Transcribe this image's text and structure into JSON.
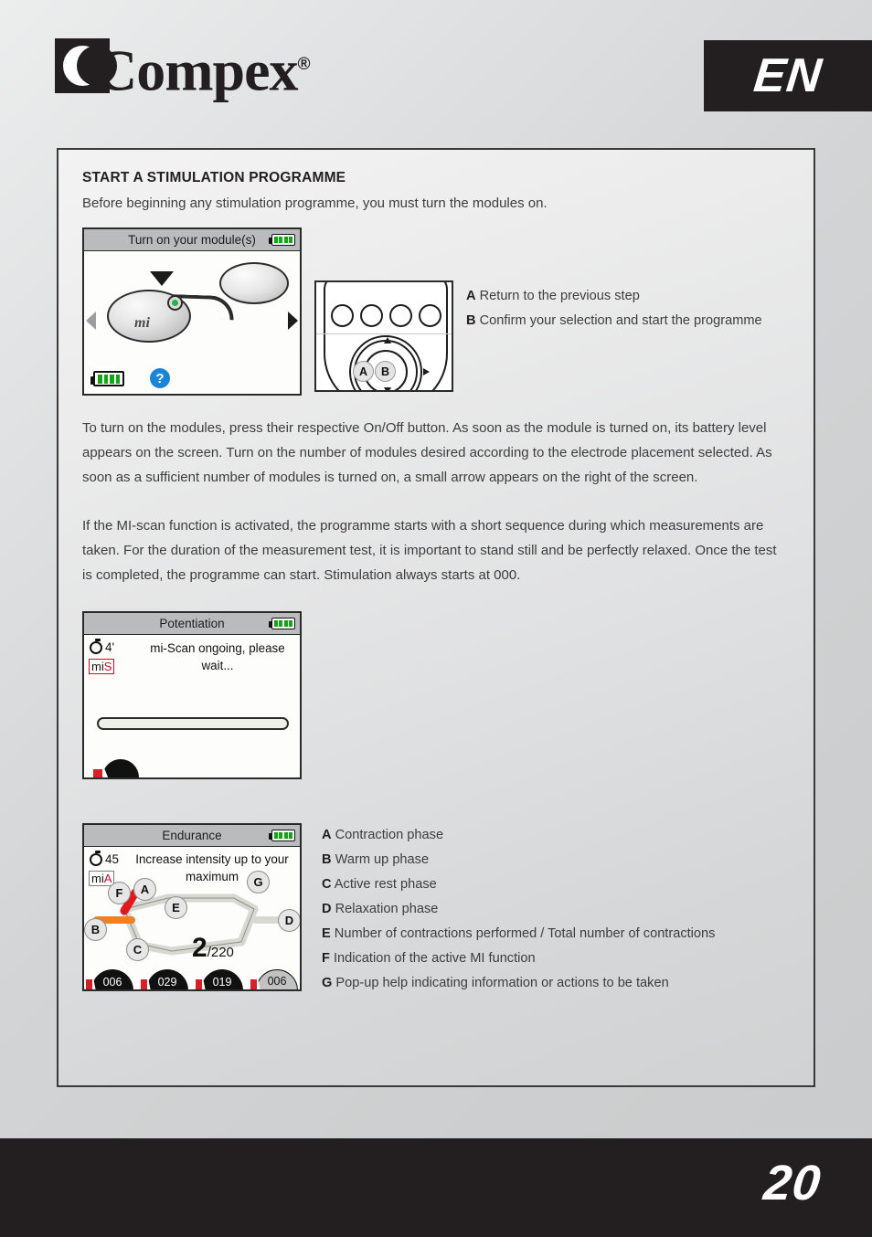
{
  "header": {
    "brand": "Compex",
    "brand_reg": "®",
    "language_tab": "EN"
  },
  "section": {
    "title": "START A STIMULATION PROGRAMME",
    "intro": "Before beginning any stimulation programme, you must turn the modules on.",
    "paragraph_1": "To turn on the modules, press their respective On/Off button. As soon as the module is turned on, its battery level appears on the screen. Turn on the number of modules desired according to the electrode placement selected. As soon as a sufficient number of modules is turned on, a small arrow appears on the right of the screen.",
    "paragraph_2": "If the MI-scan function is activated, the programme starts with a short sequence during which measurements are taken. For the duration of the measurement test, it is important to stand still and be perfectly relaxed. Once the test is completed, the programme can start. Stimulation always starts at 000."
  },
  "screen_turn_on": {
    "title": "Turn on your module(s)",
    "module_label": "mi",
    "help_glyph": "?"
  },
  "button_pad": {
    "label_a": "A",
    "label_b": "B"
  },
  "button_legend": [
    {
      "key": "A",
      "text": "Return to the previous step"
    },
    {
      "key": "B",
      "text": "Confirm your selection and start the programme"
    }
  ],
  "screen_potentiation": {
    "title": "Potentiation",
    "timer": "4'",
    "mi_badge_prefix": "mi",
    "mi_badge_suffix": "S",
    "message": "mi-Scan ongoing, please wait..."
  },
  "screen_endurance": {
    "title": "Endurance",
    "timer": "45",
    "mi_badge_prefix": "mi",
    "mi_badge_suffix": "A",
    "message": "Increase intensity up to your maximum",
    "contractions_done": "2",
    "contractions_total": "/220",
    "callouts": [
      "A",
      "B",
      "C",
      "D",
      "E",
      "F",
      "G"
    ],
    "channels": [
      {
        "value": "006",
        "active": true
      },
      {
        "value": "029",
        "active": true
      },
      {
        "value": "019",
        "active": true
      },
      {
        "value": "006",
        "active": false
      }
    ]
  },
  "endurance_legend": [
    {
      "key": "A",
      "text": "Contraction phase"
    },
    {
      "key": "B",
      "text": "Warm up phase"
    },
    {
      "key": "C",
      "text": "Active rest phase"
    },
    {
      "key": "D",
      "text": "Relaxation phase"
    },
    {
      "key": "E",
      "text": "Number of contractions performed / Total number of contractions"
    },
    {
      "key": "F",
      "text": "Indication of the active MI function"
    },
    {
      "key": "G",
      "text": "Pop-up help indicating information or actions to be taken"
    }
  ],
  "footer": {
    "page_number": "20"
  },
  "colors": {
    "page_bg": "#cdcfd0",
    "dark": "#231f20",
    "accent_red": "#d81f28",
    "accent_orange": "#f08020",
    "battery_green": "#17a317",
    "help_blue": "#1a84d6"
  }
}
